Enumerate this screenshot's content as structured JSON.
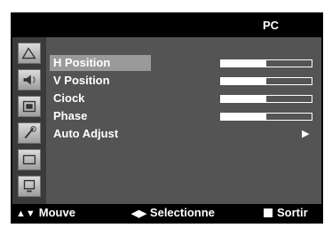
{
  "title": "PC",
  "sidebar": {
    "icons": [
      "picture-icon",
      "sound-icon",
      "channel-icon",
      "setup-icon",
      "input-icon",
      "pc-icon"
    ]
  },
  "menu": {
    "items": [
      {
        "label": "H Position",
        "type": "slider",
        "value": 0.5,
        "selected": true
      },
      {
        "label": "V Position",
        "type": "slider",
        "value": 0.5,
        "selected": false
      },
      {
        "label": "Ciock",
        "type": "slider",
        "value": 0.5,
        "selected": false
      },
      {
        "label": "Phase",
        "type": "slider",
        "value": 0.5,
        "selected": false
      },
      {
        "label": "Auto Adjust",
        "type": "submenu",
        "selected": false
      }
    ]
  },
  "footer": {
    "move_label": "Mouve",
    "select_label": "Selectionne",
    "exit_label": "Sortir"
  },
  "colors": {
    "panel": "#545454",
    "selected": "#9a9a9a",
    "background": "#000000"
  }
}
